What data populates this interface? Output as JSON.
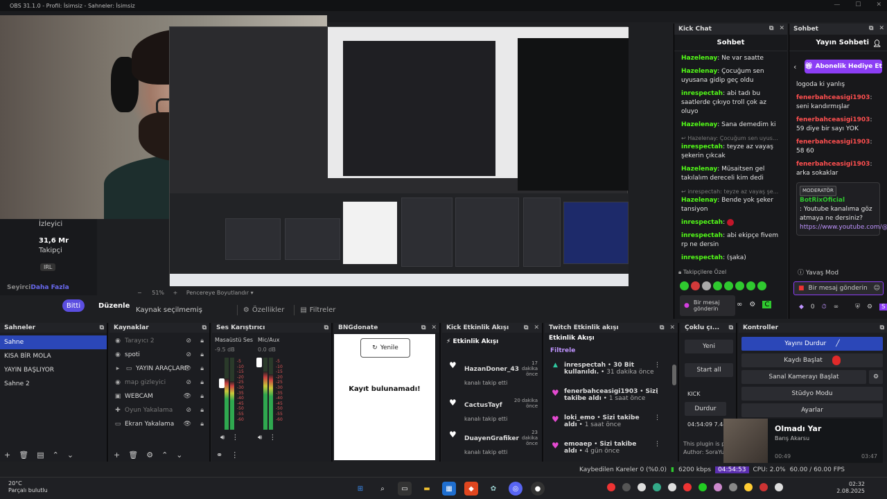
{
  "window": {
    "title": "OBS 31.1.0 - Profil: İsimsiz - Sahneler: İsimsiz"
  },
  "left_info": {
    "viewers_label": "İzleyici",
    "followers_value": "31,6 Mr",
    "followers_label": "Takipçi",
    "irl": "IRL",
    "audience": "Seyirci",
    "more": "Daha Fazla",
    "done_btn": "Bitti",
    "edit_btn": "Düzenle"
  },
  "preview_bar": {
    "zoom": "51%",
    "fit": "Pencereye Boyutlandır"
  },
  "source_bar": {
    "no_source": "Kaynak seçilmemiş",
    "properties": "Özellikler",
    "filters": "Filtreler"
  },
  "kick_chat": {
    "dock_title": "Kick Chat",
    "header": "Sohbet",
    "messages": [
      {
        "user": "Hazelenay",
        "text": "Ne var saatte"
      },
      {
        "user": "Hazelenay",
        "text": "Çocuğum sen uyusana gidip geç oldu"
      },
      {
        "user": "inrespectah",
        "text": "abi tadı bu saatlerde çıkıyo troll çok az oluyo"
      },
      {
        "user": "Hazelenay",
        "text": "Sana demedim ki"
      },
      {
        "reply": "Hazelenay: Çocuğum sen uyus...",
        "user": "inrespectah",
        "text": "teyze az vayaş şekerin çıkcak"
      },
      {
        "user": "Hazelenay",
        "text": "Müsaitsen gel takılalım dereceli kim dedi"
      },
      {
        "reply": "inrespectah: teyze az vayaş şe...",
        "user": "Hazelenay",
        "text": "Bende yok şeker tansiyon"
      },
      {
        "user": "inrespectah",
        "text": ""
      },
      {
        "user": "inrespectah",
        "text": "abi ekipçe fivem rp ne dersin"
      },
      {
        "user": "inrespectah",
        "text": "(şaka)"
      }
    ],
    "emote_label": "Takipçilere Özel",
    "input_placeholder": "Bir mesaj gönderin"
  },
  "twitch_chat": {
    "dock_title": "Sohbet",
    "header": "Yayın Sohbeti",
    "gift_btn": "Abonelik Hediye Et",
    "top_text": "logoda ki yanlış",
    "messages": [
      {
        "user": "fenerbahceasigi1903",
        "text": "seni kandırmışlar"
      },
      {
        "user": "fenerbahceasigi1903",
        "text": "59 diye bir sayı YOK"
      },
      {
        "user": "fenerbahceasigi1903",
        "text": "58 60"
      },
      {
        "user": "fenerbahceasigi1903",
        "text": "arka sokaklar"
      }
    ],
    "mod": {
      "badge": "MODERATÖR",
      "user": "BotRixOficial",
      "text": ": Youtube kanalıma göz atmaya ne dersiniz?",
      "link": "https://www.youtube.com/@Dontachi"
    },
    "slow_mode": "Yavaş Mod",
    "input_placeholder": "Bir mesaj gönderin",
    "points": "0"
  },
  "scenes": {
    "title": "Sahneler",
    "items": [
      "Sahne",
      "KISA BİR MOLA",
      "YAYIN BAŞLIYOR",
      "Sahne 2"
    ]
  },
  "sources": {
    "title": "Kaynaklar",
    "items": [
      {
        "name": "Tarayıcı 2",
        "dim": true,
        "icon": "globe-icon"
      },
      {
        "name": "spoti",
        "dim": false,
        "icon": "globe-icon"
      },
      {
        "name": "YAYIN ARAÇLARI",
        "dim": false,
        "icon": "folder-icon"
      },
      {
        "name": "map gizleyici",
        "dim": true,
        "icon": "globe-icon"
      },
      {
        "name": "WEBCAM",
        "dim": false,
        "icon": "camera-icon"
      },
      {
        "name": "Oyun Yakalama",
        "dim": true,
        "icon": "gamepad-icon"
      },
      {
        "name": "Ekran Yakalama",
        "dim": false,
        "icon": "monitor-icon"
      }
    ]
  },
  "mixer": {
    "title": "Ses Karıştırıcı",
    "channels": [
      {
        "name": "Masaüstü Ses",
        "db": "-9.5 dB"
      },
      {
        "name": "Mic/Aux",
        "db": "0.0 dB"
      }
    ],
    "scale": [
      "-5",
      "-10",
      "-15",
      "-20",
      "-25",
      "-30",
      "-35",
      "-40",
      "-45",
      "-50",
      "-55",
      "-60"
    ]
  },
  "bng": {
    "title": "BNGdonate",
    "refresh": "Yenile",
    "empty": "Kayıt bulunamadı!"
  },
  "kick_feed": {
    "title": "Kick Etkinlik Akışı",
    "header": "Etkinlik Akışı",
    "items": [
      {
        "user": "HazanDoner_43",
        "action": "kanalı takip etti",
        "time": "17 dakika önce"
      },
      {
        "user": "CactusTayf",
        "action": "kanalı takip etti",
        "time": "20 dakika önce"
      },
      {
        "user": "DuayenGrafiker",
        "action": "kanalı takip etti",
        "time": "23 dakika önce"
      }
    ]
  },
  "twitch_feed": {
    "title": "Twitch Etkinlik akışı",
    "header": "Etkinlik Akışı",
    "filter": "Filtrele",
    "items": [
      {
        "user": "inrespectah",
        "detail": "30 Bit",
        "detail2": "kullanıldı.",
        "time": "31 dakika önce"
      },
      {
        "user": "fenerbahceasigi1903",
        "detail": "Sizi",
        "detail2": "takibe aldı",
        "time": "1 saat önce"
      },
      {
        "user": "loki_emo",
        "detail": "Sizi takibe",
        "detail2": "aldı",
        "time": "1 saat önce"
      },
      {
        "user": "emoaep",
        "detail": "Sizi takibe",
        "detail2": "aldı",
        "time": "4 gün önce"
      }
    ]
  },
  "multi": {
    "title": "Çoklu çı...",
    "new_btn": "Yeni",
    "start_all": "Start all",
    "kick": "KICK",
    "stop": "Durdur",
    "time": "04:54:09",
    "kbps": "7.44",
    "plugin": "This plugin is p",
    "author": "Author: SoraYu"
  },
  "controls": {
    "title": "Kontroller",
    "stop_stream": "Yayını Durdur",
    "start_record": "Kaydı Başlat",
    "virtual_cam": "Sanal Kamerayı Başlat",
    "studio": "Stüdyo Modu",
    "settings": "Ayarlar"
  },
  "music": {
    "title": "Olmadı Yar",
    "artist": "Barış Akarsu",
    "elapsed": "00:49",
    "total": "03:47"
  },
  "status": {
    "dropped": "Kaybedilen Kareler 0 (%0.0)",
    "bitrate": "6200 kbps",
    "stream_time": "04:54:53",
    "cpu": "CPU: 2.0%",
    "fps": "60.00 / 60.00 FPS"
  },
  "taskbar": {
    "temp": "20°C",
    "weather": "Parçalı bulutlu",
    "time": "02:32",
    "date": "2.08.2025"
  }
}
